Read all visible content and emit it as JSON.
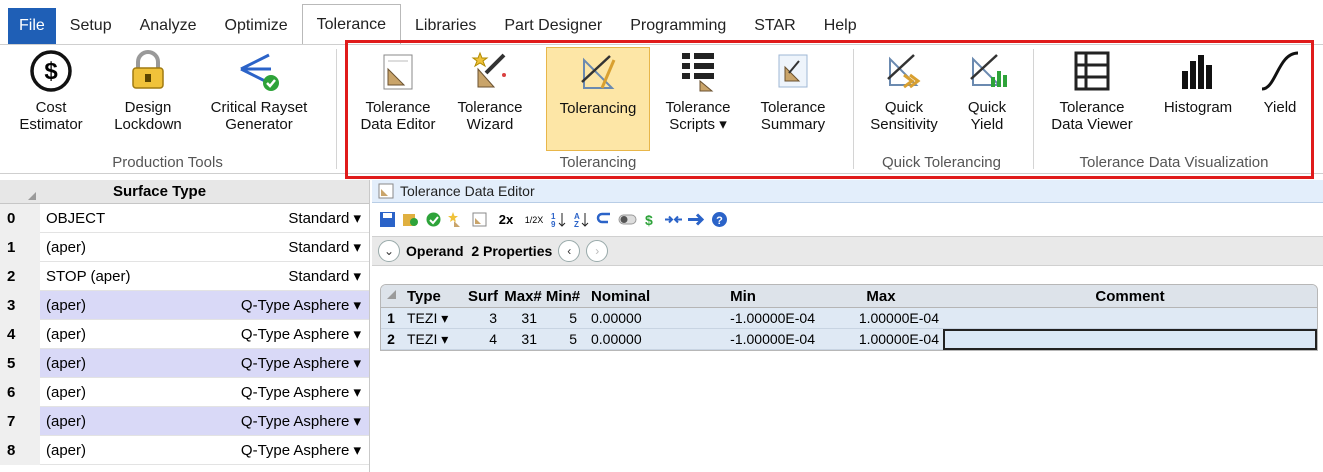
{
  "menu": [
    "File",
    "Setup",
    "Analyze",
    "Optimize",
    "Tolerance",
    "Libraries",
    "Part Designer",
    "Programming",
    "STAR",
    "Help"
  ],
  "menu_active": "Tolerance",
  "ribbon": {
    "production_tools": {
      "title": "Production Tools",
      "cost_estimator": [
        "Cost",
        "Estimator"
      ],
      "design_lockdown": [
        "Design",
        "Lockdown"
      ],
      "critical_rayset": [
        "Critical Rayset",
        "Generator"
      ]
    },
    "tolerancing": {
      "title": "Tolerancing",
      "data_editor": [
        "Tolerance",
        "Data Editor"
      ],
      "wizard": [
        "Tolerance",
        "Wizard"
      ],
      "tolerancing": [
        "Tolerancing",
        ""
      ],
      "scripts": [
        "Tolerance",
        "Scripts ▾"
      ],
      "summary": [
        "Tolerance",
        "Summary"
      ]
    },
    "quick_tolerancing": {
      "title": "Quick Tolerancing",
      "sensitivity": [
        "Quick",
        "Sensitivity"
      ],
      "yield": [
        "Quick",
        "Yield"
      ]
    },
    "visualization": {
      "title": "Tolerance Data Visualization",
      "data_viewer": [
        "Tolerance",
        "Data Viewer"
      ],
      "histogram": "Histogram",
      "yield": "Yield"
    }
  },
  "surface_table": {
    "header": "Surface Type",
    "rows": [
      {
        "num": "0",
        "comment": "OBJECT",
        "type": "Standard ▾"
      },
      {
        "num": "1",
        "comment": "(aper)",
        "type": "Standard ▾"
      },
      {
        "num": "2",
        "comment": "STOP (aper)",
        "type": "Standard ▾"
      },
      {
        "num": "3",
        "comment": "(aper)",
        "type": "Q-Type Asphere ▾"
      },
      {
        "num": "4",
        "comment": "(aper)",
        "type": "Q-Type Asphere ▾"
      },
      {
        "num": "5",
        "comment": "(aper)",
        "type": "Q-Type Asphere ▾"
      },
      {
        "num": "6",
        "comment": "(aper)",
        "type": "Q-Type Asphere ▾"
      },
      {
        "num": "7",
        "comment": "(aper)",
        "type": "Q-Type Asphere ▾"
      },
      {
        "num": "8",
        "comment": "(aper)",
        "type": "Q-Type Asphere ▾"
      }
    ]
  },
  "editor": {
    "title": "Tolerance Data Editor",
    "operand_bar": "Operand  2 Properties",
    "toolbar": {
      "zoom2x": "2x",
      "zoomhalf": "1/2X"
    },
    "columns": [
      "Type",
      "Surf",
      "Max#",
      "Min#",
      "Nominal",
      "Min",
      "Max",
      "Comment"
    ],
    "rows": [
      {
        "num": "1",
        "type": "TEZI ▾",
        "surf": "3",
        "max_n": "31",
        "min_n": "5",
        "nominal": "0.00000",
        "min": "-1.00000E-04",
        "max": "1.00000E-04",
        "comment": ""
      },
      {
        "num": "2",
        "type": "TEZI ▾",
        "surf": "4",
        "max_n": "31",
        "min_n": "5",
        "nominal": "0.00000",
        "min": "-1.00000E-04",
        "max": "1.00000E-04",
        "comment": ""
      }
    ]
  },
  "colors": {
    "file_tab": "#1f5fb6",
    "highlight_box": "#e01b1b",
    "selected_button": "#fde6a6",
    "alt_row": "#d9d9f7"
  }
}
